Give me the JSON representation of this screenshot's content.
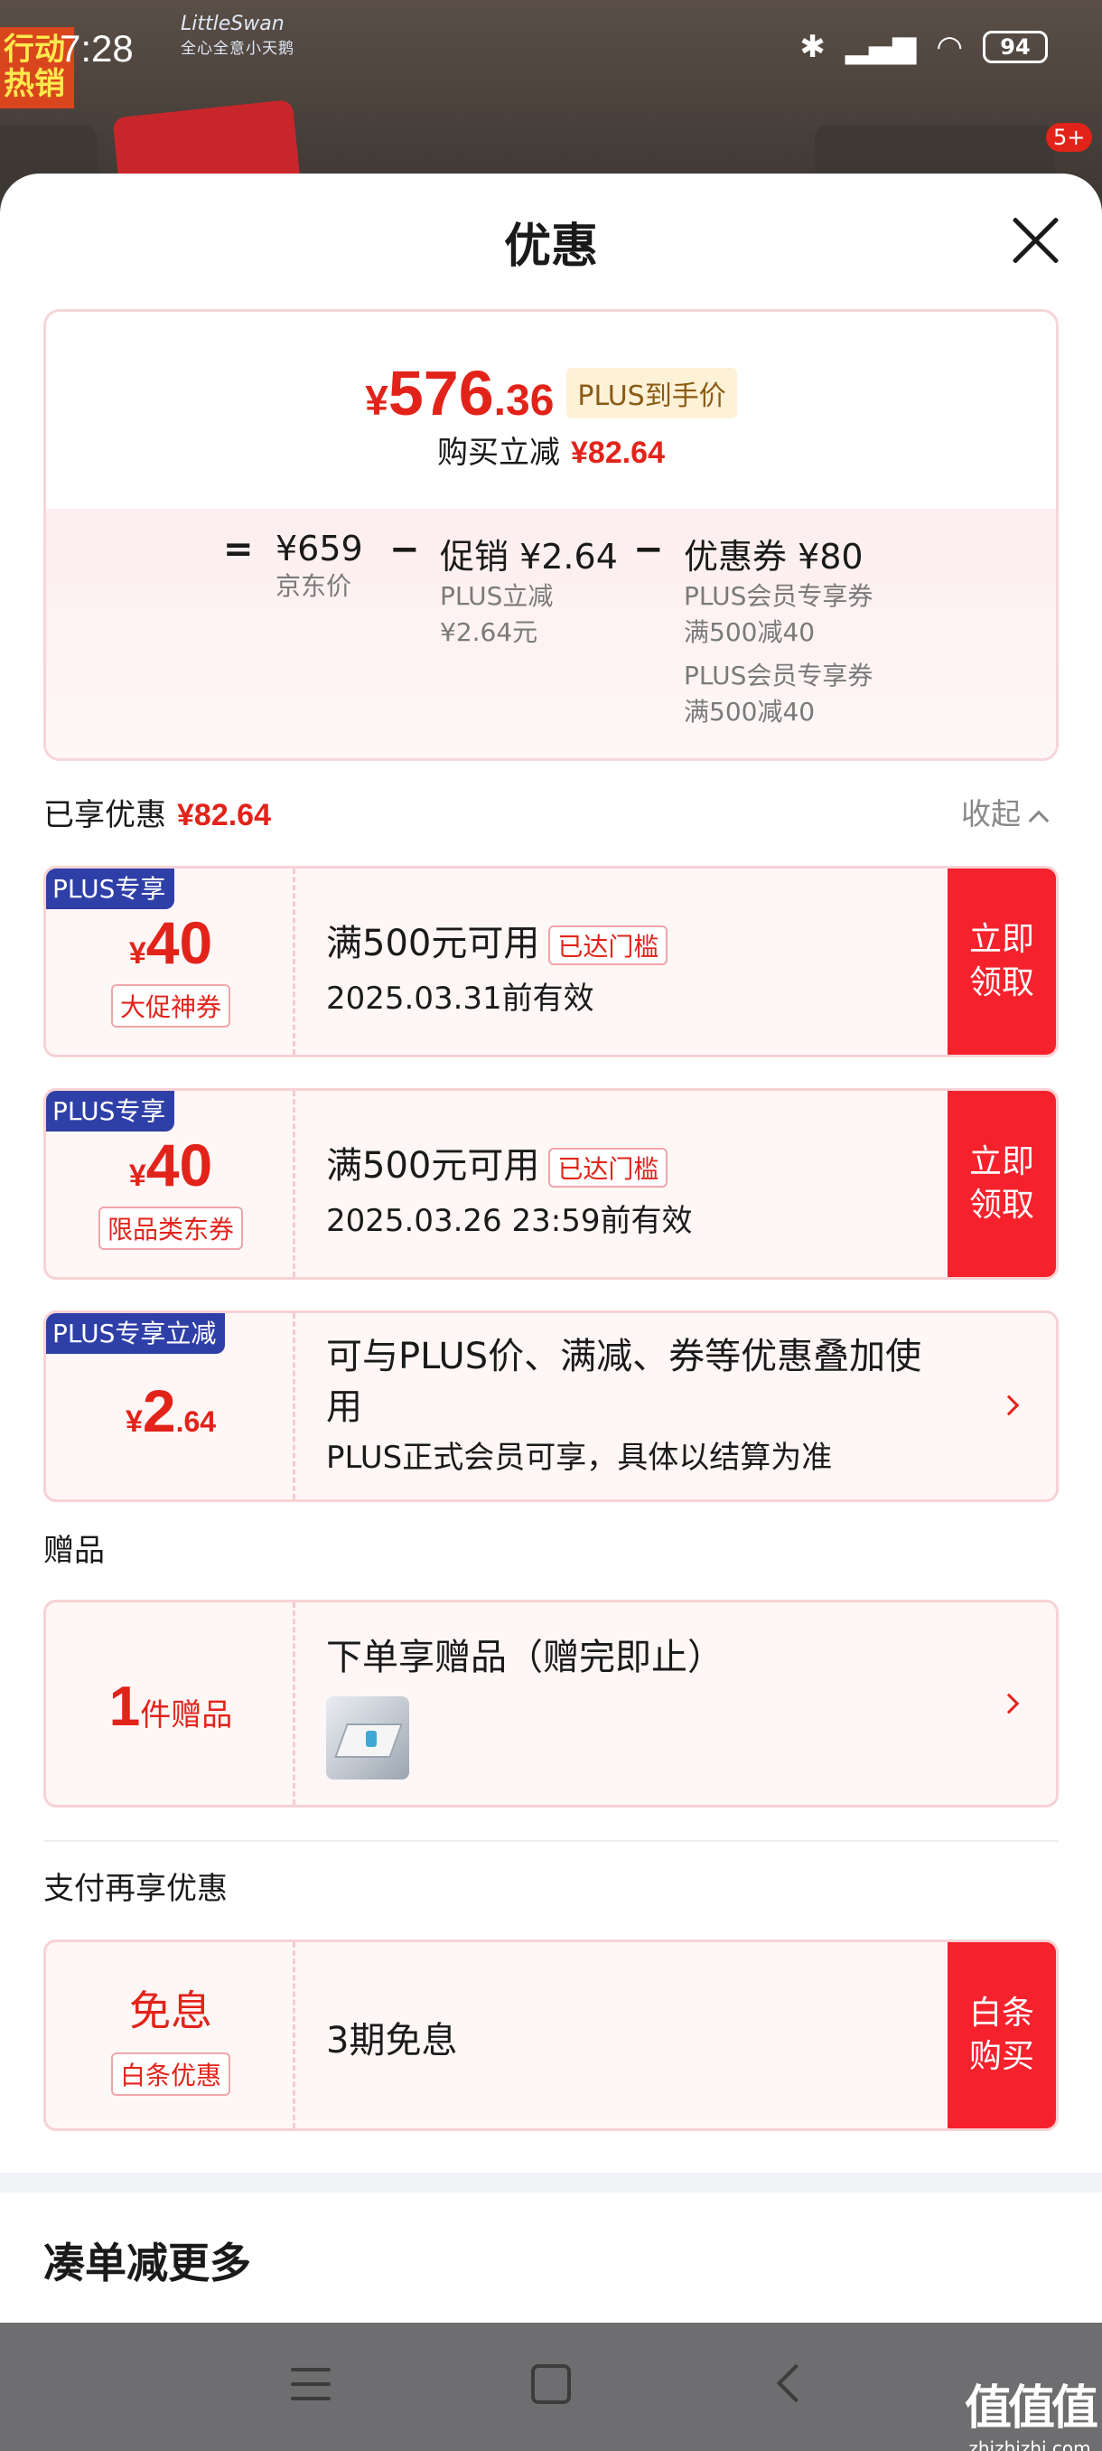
{
  "status_bar": {
    "time": "7:28",
    "battery": "94"
  },
  "background": {
    "brand_logo": "LittleSwan",
    "brand_sub": "全心全意小天鹅",
    "left_banner": "行动热销",
    "cart_badge": "5+"
  },
  "sheet": {
    "title": "优惠",
    "price_summary": {
      "price_yen": "¥",
      "price_int": "576",
      "price_dec": ".36",
      "price_tag": "PLUS到手价",
      "reduce_label": "购买立减",
      "reduce_amount": "¥82.64",
      "eq": "=",
      "jd_price": "¥659",
      "jd_label": "京东价",
      "minus1": "−",
      "promo": "促销 ¥2.64",
      "promo_sub1": "PLUS立减",
      "promo_sub2": "¥2.64元",
      "minus2": "−",
      "coupon": "优惠券 ¥80",
      "coupon_sub1": "PLUS会员专享券",
      "coupon_sub2": "满500减40",
      "coupon_sub3": "PLUS会员专享券",
      "coupon_sub4": "满500减40"
    },
    "enjoyed": {
      "label": "已享优惠",
      "amount": "¥82.64",
      "collapse": "收起"
    },
    "coupons": [
      {
        "ribbon": "PLUS专享",
        "yen": "¥",
        "amount": "40",
        "type": "大促神券",
        "title": "满500元可用",
        "threshold": "已达门槛",
        "validity": "2025.03.31前有效",
        "action": "立即领取"
      },
      {
        "ribbon": "PLUS专享",
        "yen": "¥",
        "amount": "40",
        "type": "限品类东券",
        "title": "满500元可用",
        "threshold": "已达门槛",
        "validity": "2025.03.26 23:59前有效",
        "action": "立即领取"
      }
    ],
    "plus_discount": {
      "ribbon": "PLUS专享立减",
      "yen": "¥",
      "amount": "2",
      "dec": ".64",
      "title": "可与PLUS价、满减、券等优惠叠加使用",
      "desc": "PLUS正式会员可享，具体以结算为准"
    },
    "gift": {
      "section": "赠品",
      "count": "1",
      "unit": "件赠品",
      "title": "下单享赠品（赠完即止）"
    },
    "payment": {
      "section": "支付再享优惠",
      "main": "免息",
      "tag": "白条优惠",
      "title": "3期免息",
      "action": "白条购买"
    },
    "more": {
      "title": "凑单减更多"
    }
  },
  "watermark": {
    "main": "值值值",
    "sub": "zhizhizhi.com"
  },
  "colors": {
    "accent": "#e2231a",
    "plus_blue": "#2f3fa8",
    "action_red": "#f5222d"
  }
}
